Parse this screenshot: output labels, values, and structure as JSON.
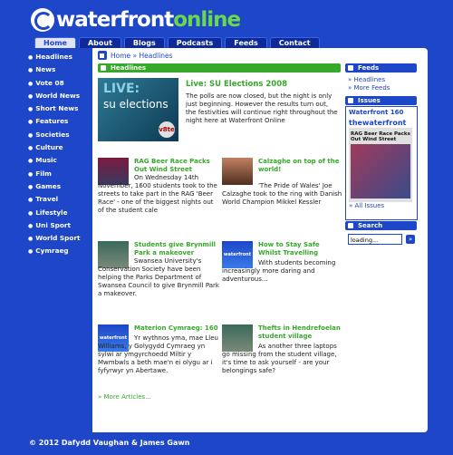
{
  "logo": {
    "part1": "waterfront",
    "part2": "online"
  },
  "nav": [
    "Home",
    "About",
    "Blogs",
    "Podcasts",
    "Feeds",
    "Contact"
  ],
  "sidebar": [
    "Headlines",
    "News",
    "Vote 08",
    "World News",
    "Short News",
    "Features",
    "Societies",
    "Culture",
    "Music",
    "Film",
    "Games",
    "Travel",
    "Lifestyle",
    "Uni Sport",
    "World Sport",
    "Cymraeg"
  ],
  "breadcrumb": "Home » Headlines",
  "headlines_label": "Headlines",
  "lead": {
    "image_line1": "LIVE:",
    "image_line2": "su elections",
    "image_badge": "v8te",
    "title": "Live: SU Elections 2008",
    "body": "The polls are now closed, but the night is only just beginning. However the results turn out, the festivities will continue right throughout the night here at Waterfront Online"
  },
  "articles": [
    {
      "title": "RAG Beer Race Packs Out Wind Street",
      "body": "On Wednesday 14th November, 1600 students took to the streets to take part in the RAG 'Beer Race' - one of the biggest nights out of the student cale"
    },
    {
      "title": "Calzaghe on top of the world!",
      "body": "'The Pride of Wales' Joe Calzaghe took to the ring with Danish World Champion Mikkel Kessler"
    },
    {
      "title": "Students give Brynmill Park a makeover",
      "body": "Swansea University's Conservation Society have been helping the Parks Department of Swansea Council to give Brynmill Park a makeover."
    },
    {
      "title": "How to Stay Safe Whilst Travelling",
      "body": "With students becoming increasingly more daring and adventurous..."
    },
    {
      "title": "Materion Cymraeg: 160",
      "body": "Yr wythnos yma, mae Lleu Williams, y Golygydd Cymraeg yn sylwi ar ymgyrchoedd Miltir y Mwmbwls a beth mae'n ei olygu ar i fyfyrwyr yn Abertawe."
    },
    {
      "title": "Thefts in Hendrefoelan student village",
      "body": "As another three laptops go missing from the student village, it's time to ask yourself - are your belongings safe?"
    }
  ],
  "image_labels": {
    "wf": "waterfront"
  },
  "more_articles": "» More Articles...",
  "feeds": {
    "label": "Feeds",
    "links": [
      "» Headlines",
      "» More Feeds"
    ]
  },
  "issues": {
    "label": "Issues",
    "title": "Waterfront 160",
    "masthead": "thewaterfront",
    "cover_headline": "RAG Beer Race Packs Out Wind Street",
    "links": [
      "» All Issues"
    ]
  },
  "search": {
    "label": "Search",
    "placeholder": "loading...",
    "button": "»"
  },
  "footer": "© 2012 Dafydd Vaughan & James Gawn"
}
